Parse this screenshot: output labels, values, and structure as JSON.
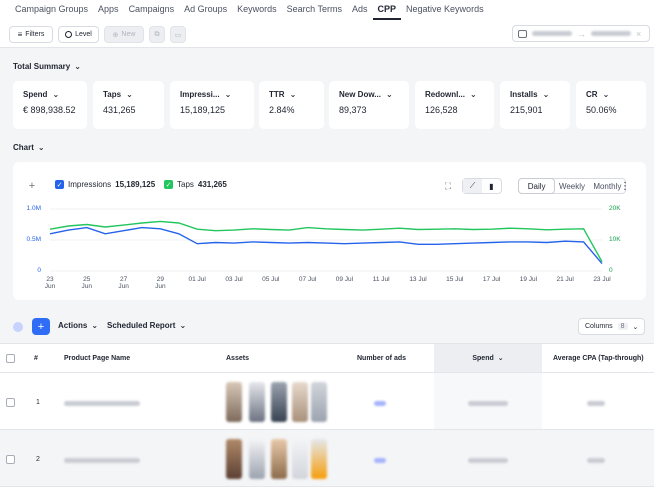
{
  "nav": {
    "tabs": [
      {
        "label": "Campaign Groups"
      },
      {
        "label": "Apps"
      },
      {
        "label": "Campaigns"
      },
      {
        "label": "Ad Groups"
      },
      {
        "label": "Keywords"
      },
      {
        "label": "Search Terms"
      },
      {
        "label": "Ads"
      },
      {
        "label": "CPP"
      },
      {
        "label": "Negative Keywords"
      }
    ],
    "active": "CPP"
  },
  "toolbar": {
    "filters_label": "Filters",
    "level_label": "Level",
    "new_label": "New"
  },
  "summary": {
    "title": "Total Summary",
    "cards": [
      {
        "label": "Spend",
        "value": "€ 898,938.52"
      },
      {
        "label": "Taps",
        "value": "431,265"
      },
      {
        "label": "Impressi...",
        "value": "15,189,125"
      },
      {
        "label": "TTR",
        "value": "2.84%"
      },
      {
        "label": "New Dow...",
        "value": "89,373"
      },
      {
        "label": "Redownl...",
        "value": "126,528"
      },
      {
        "label": "Installs",
        "value": "215,901"
      },
      {
        "label": "CR",
        "value": "50.06%"
      }
    ]
  },
  "chart": {
    "title": "Chart",
    "add_label": "+",
    "legend": {
      "impressions_label": "Impressions",
      "impressions_total": "15,189,125",
      "taps_label": "Taps",
      "taps_total": "431,265"
    },
    "granularity": {
      "daily": "Daily",
      "weekly": "Weekly",
      "monthly": "Monthly",
      "selected": "Daily"
    },
    "more_label": "⋮"
  },
  "chart_data": {
    "type": "line",
    "x": [
      "23 Jun",
      "24 Jun",
      "25 Jun",
      "26 Jun",
      "27 Jun",
      "28 Jun",
      "29 Jun",
      "30 Jun",
      "01 Jul",
      "02 Jul",
      "03 Jul",
      "04 Jul",
      "05 Jul",
      "06 Jul",
      "07 Jul",
      "08 Jul",
      "09 Jul",
      "10 Jul",
      "11 Jul",
      "12 Jul",
      "13 Jul",
      "14 Jul",
      "15 Jul",
      "16 Jul",
      "17 Jul",
      "18 Jul",
      "19 Jul",
      "20 Jul",
      "21 Jul",
      "22 Jul",
      "23 Jul"
    ],
    "tick_labels": [
      {
        "d": "23",
        "m": "Jun"
      },
      {
        "d": "25",
        "m": "Jun"
      },
      {
        "d": "27",
        "m": "Jun"
      },
      {
        "d": "29",
        "m": "Jun"
      },
      {
        "d": "01 Jul",
        "m": ""
      },
      {
        "d": "03 Jul",
        "m": ""
      },
      {
        "d": "05 Jul",
        "m": ""
      },
      {
        "d": "07 Jul",
        "m": ""
      },
      {
        "d": "09 Jul",
        "m": ""
      },
      {
        "d": "11 Jul",
        "m": ""
      },
      {
        "d": "13 Jul",
        "m": ""
      },
      {
        "d": "15 Jul",
        "m": ""
      },
      {
        "d": "17 Jul",
        "m": ""
      },
      {
        "d": "19 Jul",
        "m": ""
      },
      {
        "d": "21 Jul",
        "m": ""
      },
      {
        "d": "23 Jul",
        "m": ""
      }
    ],
    "series": [
      {
        "name": "Impressions",
        "axis": "left",
        "color": "#2563eb",
        "values": [
          600000,
          660000,
          700000,
          600000,
          650000,
          700000,
          680000,
          600000,
          440000,
          460000,
          450000,
          470000,
          460000,
          450000,
          460000,
          450000,
          440000,
          450000,
          460000,
          470000,
          430000,
          430000,
          440000,
          450000,
          460000,
          470000,
          470000,
          460000,
          480000,
          470000,
          120000
        ]
      },
      {
        "name": "Taps",
        "axis": "right",
        "color": "#22c55e",
        "values": [
          13500,
          14500,
          15000,
          14200,
          14800,
          15500,
          16000,
          15500,
          13500,
          13000,
          13200,
          13600,
          13400,
          13200,
          14000,
          13600,
          13400,
          13200,
          13500,
          13800,
          13400,
          13500,
          13600,
          13400,
          13500,
          13800,
          13600,
          13300,
          13500,
          13600,
          3000
        ]
      }
    ],
    "y_left": {
      "ticks": [
        "0",
        "0.5M",
        "1.0M"
      ],
      "ylim": [
        0,
        1000000
      ]
    },
    "y_right": {
      "ticks": [
        "0",
        "10K",
        "20K"
      ],
      "ylim": [
        0,
        20000
      ]
    },
    "grid": true
  },
  "table_bar": {
    "actions_label": "Actions",
    "scheduled_label": "Scheduled Report",
    "columns_label": "Columns",
    "columns_count": "8"
  },
  "table": {
    "headers": {
      "index": "#",
      "name": "Product Page Name",
      "assets": "Assets",
      "ads": "Number of ads",
      "spend": "Spend",
      "cpa": "Average CPA (Tap-through)"
    },
    "rows": [
      {
        "index": "1"
      },
      {
        "index": "2"
      }
    ]
  },
  "colors": {
    "accent": "#2563eb",
    "taps": "#22c55e",
    "primary_button": "#2f6df6"
  }
}
